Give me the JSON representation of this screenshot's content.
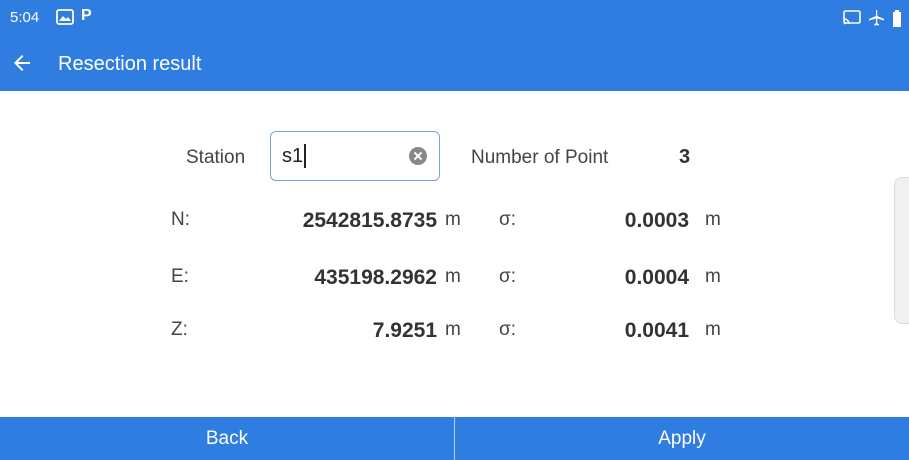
{
  "status_bar": {
    "time": "5:04",
    "icons_left": [
      "photos-icon",
      "p-icon"
    ],
    "icons_right": [
      "cast-icon",
      "airplane-mode-icon",
      "battery-icon"
    ]
  },
  "header": {
    "title": "Resection result"
  },
  "form": {
    "station_label": "Station",
    "station_value": "s1",
    "number_of_point_label": "Number of Point",
    "number_of_point_value": "3"
  },
  "results": [
    {
      "axis": "N:",
      "value": "2542815.8735",
      "unit": "m",
      "sigma_label": "σ:",
      "sigma": "0.0003",
      "sigma_unit": "m"
    },
    {
      "axis": "E:",
      "value": "435198.2962",
      "unit": "m",
      "sigma_label": "σ:",
      "sigma": "0.0004",
      "sigma_unit": "m"
    },
    {
      "axis": "Z:",
      "value": "7.9251",
      "unit": "m",
      "sigma_label": "σ:",
      "sigma": "0.0041",
      "sigma_unit": "m"
    }
  ],
  "actions": {
    "back_label": "Back",
    "apply_label": "Apply"
  },
  "colors": {
    "primary": "#2f7de0"
  }
}
